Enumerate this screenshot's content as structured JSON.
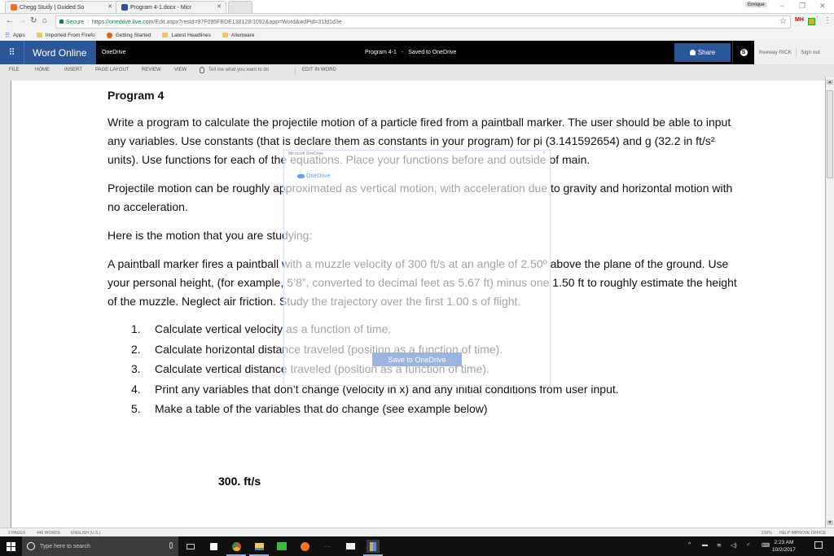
{
  "browser": {
    "tabs": [
      {
        "title": "Chegg Study | Guided So",
        "icon_color": "#f47321",
        "active": false
      },
      {
        "title": "Program 4-1.docx - Micr",
        "icon_color": "#2b579a",
        "active": true
      }
    ],
    "profile_name": "Enrique",
    "address": {
      "secure_label": "Secure",
      "url_host": "https://onedrive.live.com",
      "url_rest": "/Edit.aspx?resid=97F095FBDE138128!1092&app=Word&wdPid=31fd1d3e"
    },
    "bookmarks": [
      {
        "label": "Apps",
        "icon": "apps-grid-icon"
      },
      {
        "label": "Imported From Firefo",
        "icon": "folder-icon"
      },
      {
        "label": "Getting Started",
        "icon": "firefox-icon"
      },
      {
        "label": "Latest Headlines",
        "icon": "folder-icon"
      },
      {
        "label": "Alienware",
        "icon": "folder-icon"
      }
    ]
  },
  "word": {
    "brand": "Word Online",
    "onedrive_link": "OneDrive",
    "doc_name": "Program 4-1",
    "doc_sep": "-",
    "save_status": "Saved to OneDrive",
    "share_label": "Share",
    "user_name": "freeway RICK",
    "sign_out": "Sign out",
    "ribbon_tabs": [
      "FILE",
      "HOME",
      "INSERT",
      "PAGE LAYOUT",
      "REVIEW",
      "VIEW"
    ],
    "tell_me": "Tell me what you want to do",
    "edit_in_word": "EDIT IN WORD"
  },
  "document": {
    "heading": "Program 4",
    "paragraphs": [
      "Write a program to calculate the projectile motion of a particle fired from a paintball marker.  The user should be able to input any variables.  Use constants (that is declare them as constants in your program) for pi (3.141592654) and g (32.2 in ft/s² units).  Use functions for each of the equations.  Place your functions before and outside of main.",
      "Projectile motion can be roughly approximated as vertical motion, with acceleration due to gravity and horizontal motion with no acceleration.",
      "Here is the motion that you are studying:",
      "A paintball marker fires a paintball with a muzzle velocity of 300 ft/s at an angle of 2.50º above the plane of the ground.  Use your personal height, (for example, 5’8”, converted to decimal feet as 5.67 ft) minus one 1.50 ft to roughly estimate the height of the muzzle.  Neglect air friction.  Study the trajectory over the first 1.00 s of flight."
    ],
    "list": [
      {
        "num": "1.",
        "text": "Calculate vertical velocity as a function of time."
      },
      {
        "num": "2.",
        "text": "Calculate horizontal distance traveled (position as a function of time)."
      },
      {
        "num": "3.",
        "text": "Calculate vertical distance traveled (position as a function of time)."
      },
      {
        "num": "4.",
        "text": "Print any variables that don’t change (velocity in x) and any initial conditions from user input."
      },
      {
        "num": "5.",
        "text": "Make a table of the variables that do change (see example below)"
      }
    ],
    "figure_label": "300. ft/s"
  },
  "dialog": {
    "title": "Microsoft OneDrive",
    "logo_text": "OneDrive",
    "close": "×",
    "save_button": "Save to OneDrive"
  },
  "statusbar": {
    "pages": "2 PAGES",
    "words": "446 WORDS",
    "language": "ENGLISH (U.S.)",
    "zoom": "210%",
    "help": "HELP IMPROVE OFFICE"
  },
  "taskbar": {
    "search_placeholder": "Type here to search",
    "time": "2:23 AM",
    "date": "10/2/2017"
  }
}
